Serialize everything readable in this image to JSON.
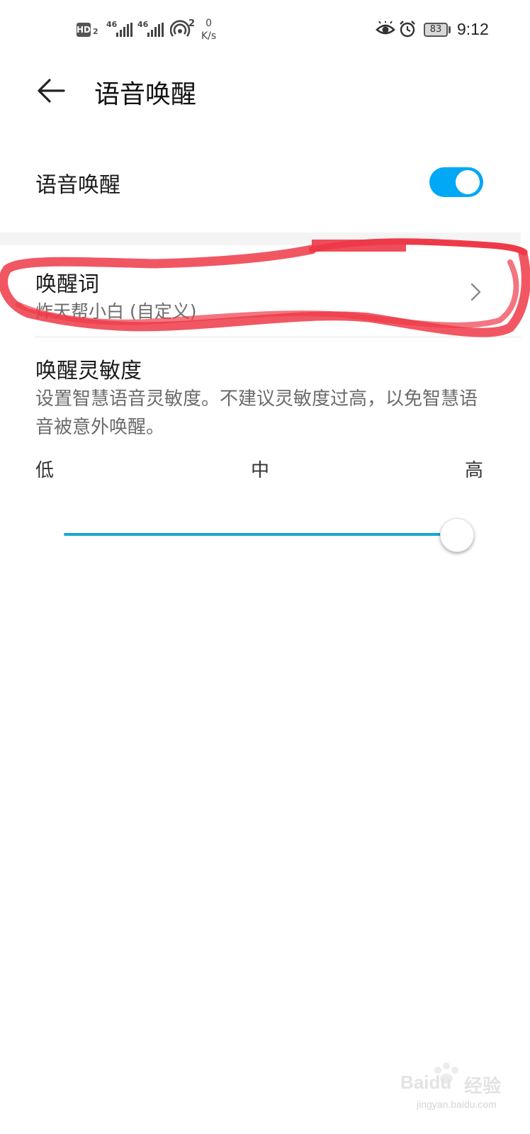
{
  "status_bar": {
    "hd_label": "HD",
    "hd_sub": "2",
    "net1_label": "46",
    "net2_label": "46",
    "hotspot_count": "2",
    "speed_value": "0",
    "speed_unit": "K/s",
    "battery": "83",
    "time": "9:12",
    "icons": [
      "eye-comfort-icon",
      "alarm-icon"
    ]
  },
  "header": {
    "back_icon": "arrow-left-icon",
    "title": "语音唤醒"
  },
  "voice_wake": {
    "label": "语音唤醒",
    "enabled": true,
    "accent": "#00a8f5"
  },
  "wake_word": {
    "title": "唤醒词",
    "value": "炸天帮小白 (自定义)"
  },
  "sensitivity": {
    "title": "唤醒灵敏度",
    "description": "设置智慧语音灵敏度。不建议灵敏度过高，以免智慧语音被意外唤醒。",
    "levels": [
      "低",
      "中",
      "高"
    ],
    "value_fraction": 1.0,
    "track_color": "#14a8d4"
  },
  "annotation": {
    "color": "#ee3a48"
  },
  "watermark": {
    "brand": "Baidu",
    "brand_cn": "经验",
    "url": "jingyan.baidu.com"
  }
}
